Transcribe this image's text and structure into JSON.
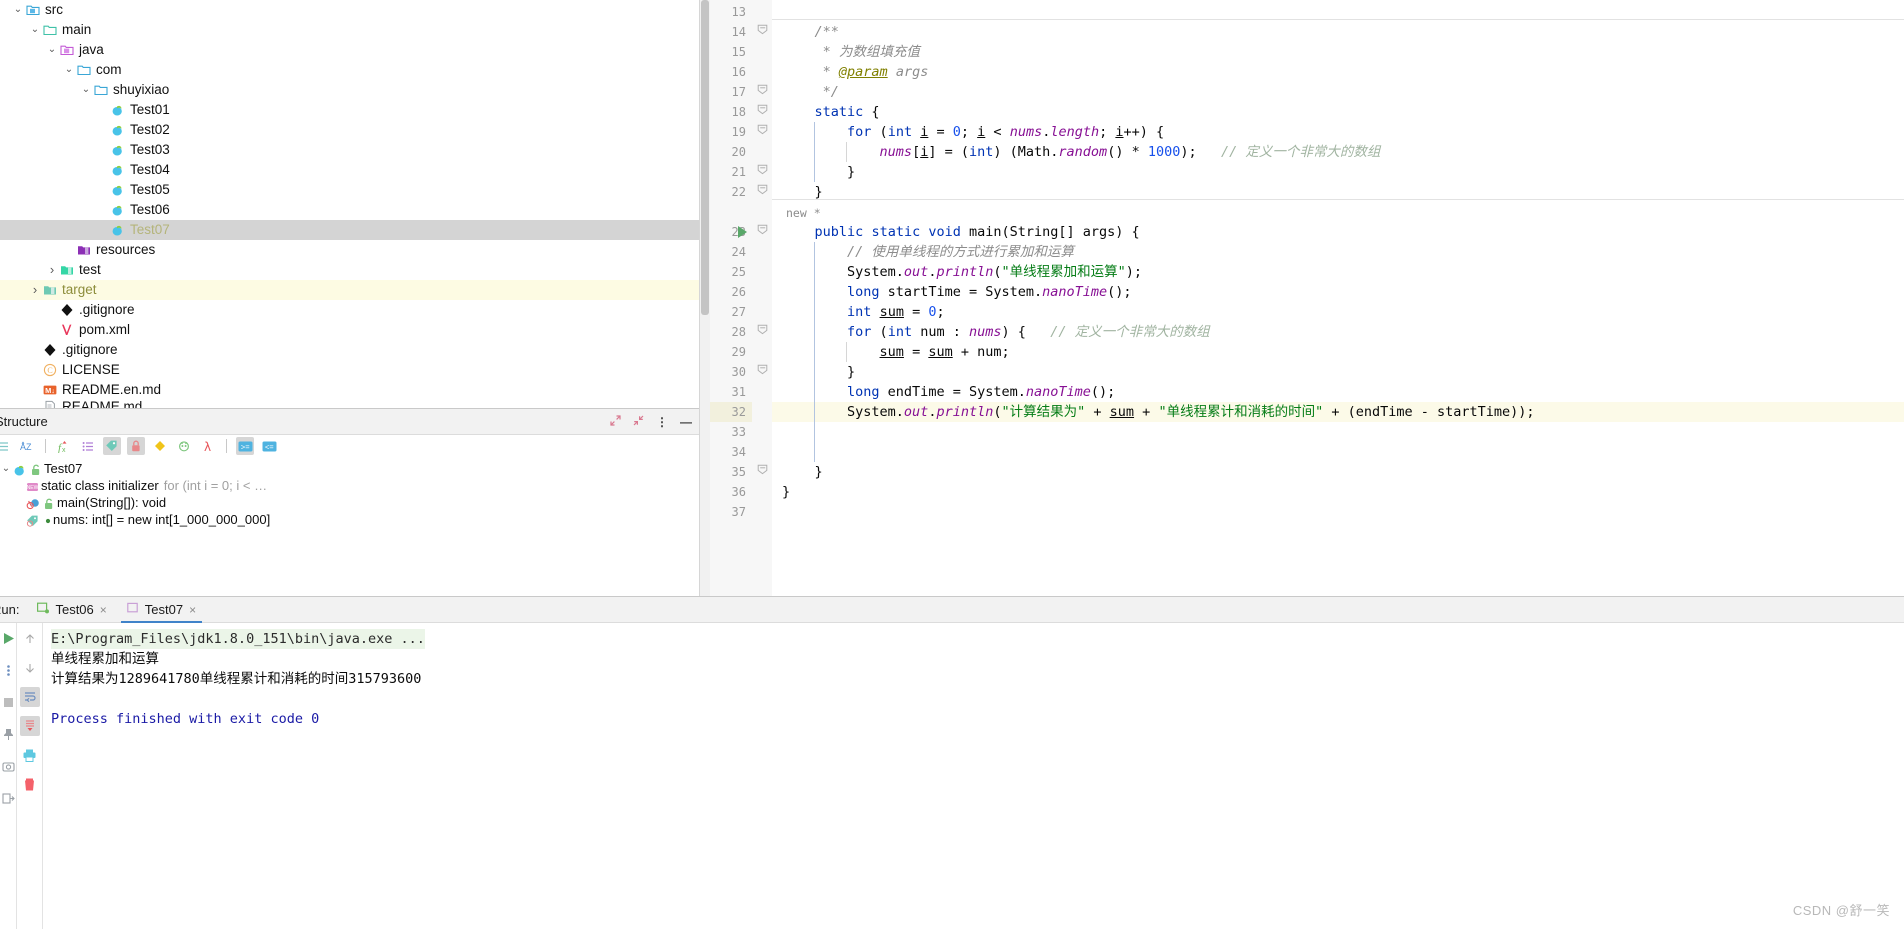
{
  "project_tree": {
    "name": "project-tree",
    "items": [
      {
        "label": "src",
        "indent": 1,
        "arrow": "v",
        "icon": "folder-src-icon",
        "state": "normal"
      },
      {
        "label": "main",
        "indent": 2,
        "arrow": "v",
        "icon": "folder-main-icon",
        "state": "normal"
      },
      {
        "label": "java",
        "indent": 3,
        "arrow": "v",
        "icon": "folder-java-icon",
        "state": "normal"
      },
      {
        "label": "com",
        "indent": 4,
        "arrow": "v",
        "icon": "folder-icon",
        "state": "normal"
      },
      {
        "label": "shuyixiao",
        "indent": 5,
        "arrow": "v",
        "icon": "folder-icon",
        "state": "normal"
      },
      {
        "label": "Test01",
        "indent": 6,
        "arrow": "",
        "icon": "java-class-icon",
        "state": "normal"
      },
      {
        "label": "Test02",
        "indent": 6,
        "arrow": "",
        "icon": "java-class-icon",
        "state": "normal"
      },
      {
        "label": "Test03",
        "indent": 6,
        "arrow": "",
        "icon": "java-class-icon",
        "state": "normal"
      },
      {
        "label": "Test04",
        "indent": 6,
        "arrow": "",
        "icon": "java-class-icon",
        "state": "normal"
      },
      {
        "label": "Test05",
        "indent": 6,
        "arrow": "",
        "icon": "java-class-icon",
        "state": "normal"
      },
      {
        "label": "Test06",
        "indent": 6,
        "arrow": "",
        "icon": "java-class-icon",
        "state": "normal"
      },
      {
        "label": "Test07",
        "indent": 6,
        "arrow": "",
        "icon": "java-class-icon",
        "state": "selected-gray"
      },
      {
        "label": "resources",
        "indent": 4,
        "arrow": "",
        "icon": "folder-resources-icon",
        "state": "normal"
      },
      {
        "label": "test",
        "indent": 3,
        "arrow": ">",
        "icon": "folder-test-icon",
        "state": "normal"
      },
      {
        "label": "target",
        "indent": 2,
        "arrow": ">",
        "icon": "folder-target-icon",
        "state": "highlight-yellow"
      },
      {
        "label": ".gitignore",
        "indent": 3,
        "arrow": "",
        "icon": "git-icon",
        "state": "normal"
      },
      {
        "label": "pom.xml",
        "indent": 3,
        "arrow": "",
        "icon": "maven-icon",
        "state": "normal"
      },
      {
        "label": ".gitignore",
        "indent": 2,
        "arrow": "",
        "icon": "git-icon",
        "state": "normal"
      },
      {
        "label": "LICENSE",
        "indent": 2,
        "arrow": "",
        "icon": "license-icon",
        "state": "normal"
      },
      {
        "label": "README.en.md",
        "indent": 2,
        "arrow": "",
        "icon": "markdown-icon",
        "state": "normal"
      },
      {
        "label": "README.md",
        "indent": 2,
        "arrow": "",
        "icon": "file-icon",
        "state": "clipped"
      }
    ]
  },
  "structure_panel": {
    "title": "Structure",
    "header_actions": [
      "expand-all-icon",
      "collapse-all-icon",
      "more-options-icon",
      "hide-icon"
    ],
    "toolbar": [
      {
        "name": "sort-by-visibility-icon",
        "glyph": "≣",
        "active": false
      },
      {
        "name": "sort-alphabetically-icon",
        "glyph": "AZ",
        "active": false
      },
      {
        "name": "show-non-public-icon",
        "glyph": "fx",
        "active": false
      },
      {
        "name": "group-methods-icon",
        "glyph": "≡",
        "active": false
      },
      {
        "name": "show-fields-icon",
        "glyph": "tag",
        "active": true
      },
      {
        "name": "show-non-public-members-icon",
        "glyph": "lock",
        "active": true
      },
      {
        "name": "show-properties-icon",
        "glyph": "diamond",
        "active": false
      },
      {
        "name": "show-anonymous-icon",
        "glyph": "anon",
        "active": false
      },
      {
        "name": "show-lambdas-icon",
        "glyph": "λ",
        "active": false
      },
      {
        "name": "expand-all-icon",
        "glyph": ">=",
        "active": true
      },
      {
        "name": "collapse-all-icon",
        "glyph": "<=",
        "active": false
      }
    ],
    "items": [
      {
        "label": "Test07",
        "detail": "",
        "indent": 0,
        "arrow": "v",
        "icons": [
          "java-class-icon",
          "unlock-icon"
        ]
      },
      {
        "label": "static class initializer",
        "detail": "for (int i = 0; i < …",
        "indent": 1,
        "arrow": "",
        "icons": [
          "initializer-icon"
        ]
      },
      {
        "label": "main(String[]): void",
        "detail": "",
        "indent": 1,
        "arrow": "",
        "icons": [
          "method-icon",
          "unlock-icon"
        ]
      },
      {
        "label": "nums: int[] = new int[1_000_000_000]",
        "detail": "",
        "indent": 1,
        "arrow": "",
        "icons": [
          "field-icon",
          "dot-icon"
        ]
      }
    ]
  },
  "editor": {
    "first_line_number": 13,
    "last_line_number": 37,
    "inlay_hint": "new *",
    "run_gutter_line": 23,
    "highlighted_line": 32,
    "lines": [
      {
        "num": 13,
        "text": "",
        "fold": ""
      },
      {
        "num": 14,
        "text": "    /**",
        "fold": "-"
      },
      {
        "num": 15,
        "text": "     * 为数组填充值",
        "fold": ""
      },
      {
        "num": 16,
        "text": "     * @param args",
        "fold": ""
      },
      {
        "num": 17,
        "text": "     */",
        "fold": "-"
      },
      {
        "num": 18,
        "text": "    static {",
        "fold": "-"
      },
      {
        "num": 19,
        "text": "        for (int i = 0; i < nums.length; i++) {",
        "fold": "-"
      },
      {
        "num": 20,
        "text": "            nums[i] = (int) (Math.random() * 1000);   // 定义一个非常大的数组",
        "fold": ""
      },
      {
        "num": 21,
        "text": "        }",
        "fold": "-"
      },
      {
        "num": 22,
        "text": "    }",
        "fold": "-"
      },
      {
        "num": 23,
        "text": "    public static void main(String[] args) {",
        "fold": "-"
      },
      {
        "num": 24,
        "text": "        // 使用单线程的方式进行累加和运算",
        "fold": ""
      },
      {
        "num": 25,
        "text": "        System.out.println(\"单线程累加和运算\");",
        "fold": ""
      },
      {
        "num": 26,
        "text": "        long startTime = System.nanoTime();",
        "fold": ""
      },
      {
        "num": 27,
        "text": "        int sum = 0;",
        "fold": ""
      },
      {
        "num": 28,
        "text": "        for (int num : nums) {   // 定义一个非常大的数组",
        "fold": "-"
      },
      {
        "num": 29,
        "text": "            sum = sum + num;",
        "fold": ""
      },
      {
        "num": 30,
        "text": "        }",
        "fold": "-"
      },
      {
        "num": 31,
        "text": "        long endTime = System.nanoTime();",
        "fold": ""
      },
      {
        "num": 32,
        "text": "        System.out.println(\"计算结果为\" + sum + \"单线程累计和消耗的时间\" + (endTime - startTime));",
        "fold": ""
      },
      {
        "num": 33,
        "text": "",
        "fold": ""
      },
      {
        "num": 34,
        "text": "",
        "fold": ""
      },
      {
        "num": 35,
        "text": "    }",
        "fold": "-"
      },
      {
        "num": 36,
        "text": "}",
        "fold": ""
      },
      {
        "num": 37,
        "text": "",
        "fold": ""
      }
    ]
  },
  "run_panel": {
    "label": "Run:",
    "tabs": [
      {
        "label": "Test06",
        "active": false,
        "running": true,
        "close": "×"
      },
      {
        "label": "Test07",
        "active": true,
        "running": false,
        "close": "×"
      }
    ],
    "left_gutter": [
      "rerun-icon",
      "more-options-icon",
      "stop-icon",
      "pin-icon",
      "camera-icon",
      "export-icon"
    ],
    "tool_column": [
      "scroll-up-icon",
      "scroll-down-icon",
      "soft-wrap-icon",
      "scroll-to-end-icon",
      "print-icon",
      "clear-all-icon"
    ],
    "console": [
      {
        "text": "E:\\Program_Files\\jdk1.8.0_151\\bin\\java.exe ...",
        "style": "cmd"
      },
      {
        "text": "单线程累加和运算",
        "style": "out"
      },
      {
        "text": "计算结果为1289641780单线程累计和消耗的时间315793600",
        "style": "out"
      },
      {
        "text": "",
        "style": "out"
      },
      {
        "text": "Process finished with exit code 0",
        "style": "fin"
      }
    ]
  },
  "watermark": "CSDN @舒一笑",
  "colors": {
    "keyword": "#0033b3",
    "string": "#067d17",
    "number": "#1750eb",
    "comment": "#8c8c8c",
    "field": "#871094",
    "selection_gray": "#d4d4d4",
    "highlight_yellow": "#fcfae8",
    "tab_underline": "#4083c9",
    "run_green": "#59a869"
  }
}
